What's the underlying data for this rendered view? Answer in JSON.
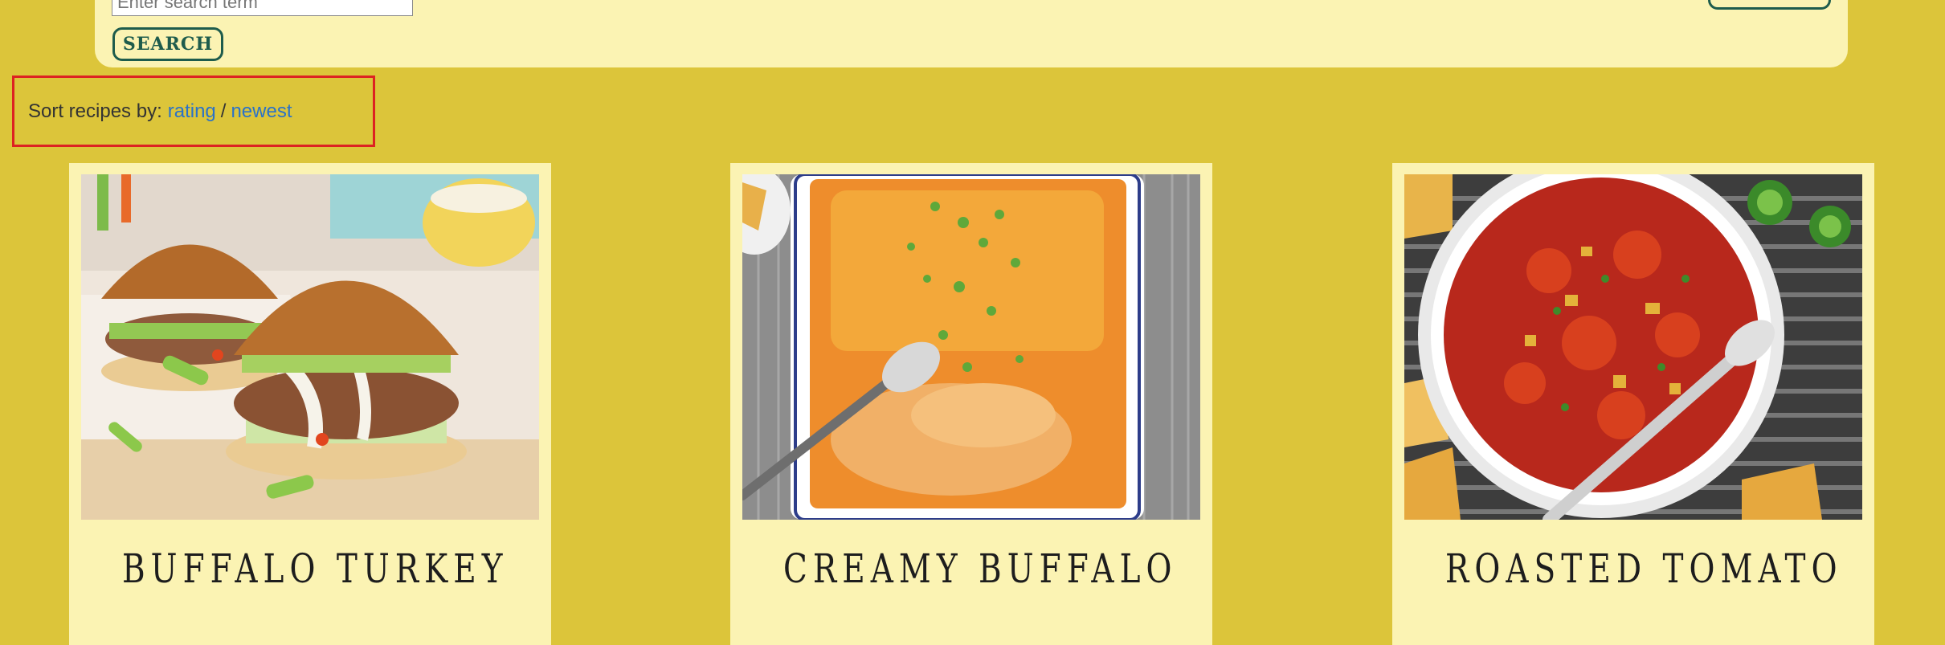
{
  "search": {
    "placeholder": "Enter search term",
    "button_label": "SEARCH"
  },
  "sort": {
    "label": "Sort recipes by:",
    "options": [
      "rating",
      "newest"
    ],
    "separator": "/"
  },
  "recipes": [
    {
      "title": "BUFFALO TURKEY"
    },
    {
      "title": "CREAMY BUFFALO"
    },
    {
      "title": "ROASTED TOMATO"
    }
  ],
  "colors": {
    "page_background": "#dcc53a",
    "panel_background": "#fbf3b3",
    "button_border": "#1e5c4c",
    "link": "#2a72c8",
    "highlight_border": "#dd2222"
  }
}
